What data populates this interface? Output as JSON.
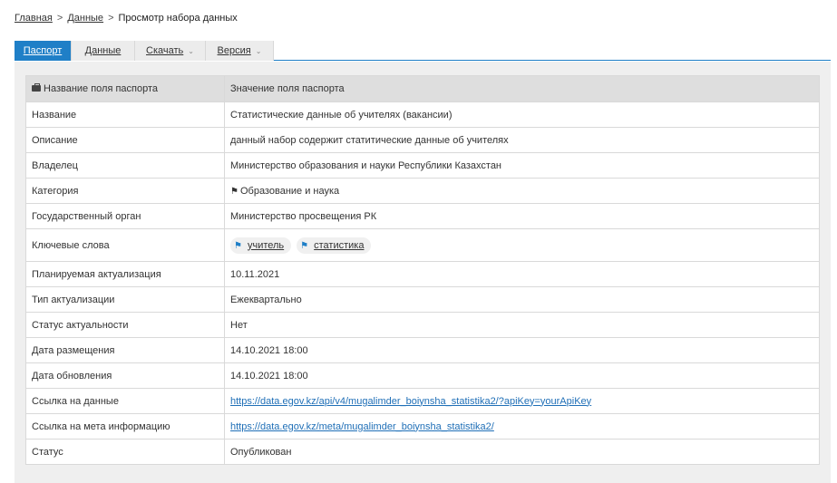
{
  "breadcrumb": {
    "home": "Главная",
    "data": "Данные",
    "current": "Просмотр набора данных"
  },
  "tabs": [
    {
      "label": "Паспорт",
      "active": true
    },
    {
      "label": "Данные"
    },
    {
      "label": "Скачать",
      "dropdown": true
    },
    {
      "label": "Версия",
      "dropdown": true
    }
  ],
  "table": {
    "header": {
      "name": "Название поля паспорта",
      "value": "Значение поля паспорта"
    },
    "rows": [
      {
        "name": "Название",
        "value": "Статистические данные об учителях (вакансии)"
      },
      {
        "name": "Описание",
        "value": "данный набор содержит статитические данные об учителях"
      },
      {
        "name": "Владелец",
        "value": "Министерство образования и науки Республики Казахстан"
      },
      {
        "name": "Категория",
        "value": "Образование и наука"
      },
      {
        "name": "Государственный орган",
        "value": "Министерство просвещения РК"
      },
      {
        "name": "Ключевые слова",
        "keywords": [
          "учитель",
          "статистика"
        ]
      },
      {
        "name": "Планируемая актуализация",
        "value": "10.11.2021"
      },
      {
        "name": "Тип актуализации",
        "value": "Ежеквартально"
      },
      {
        "name": "Статус актуальности",
        "value": "Нет"
      },
      {
        "name": "Дата размещения",
        "value": "14.10.2021 18:00"
      },
      {
        "name": "Дата обновления",
        "value": "14.10.2021 18:00"
      },
      {
        "name": "Ссылка на данные",
        "value": "https://data.egov.kz/api/v4/mugalimder_boiynsha_statistika2/?apiKey=yourApiKey"
      },
      {
        "name": "Ссылка на мета информацию",
        "value": "https://data.egov.kz/meta/mugalimder_boiynsha_statistika2/"
      },
      {
        "name": "Статус",
        "value": "Опубликован"
      }
    ]
  },
  "icons": {
    "header": "briefcase-icon",
    "category": "tag-icon",
    "keyword": "tag-icon"
  },
  "colors": {
    "accent": "#1f7fc7",
    "link": "#1f6fb7",
    "header_bg": "#dedede",
    "panel_bg": "#efefef"
  }
}
